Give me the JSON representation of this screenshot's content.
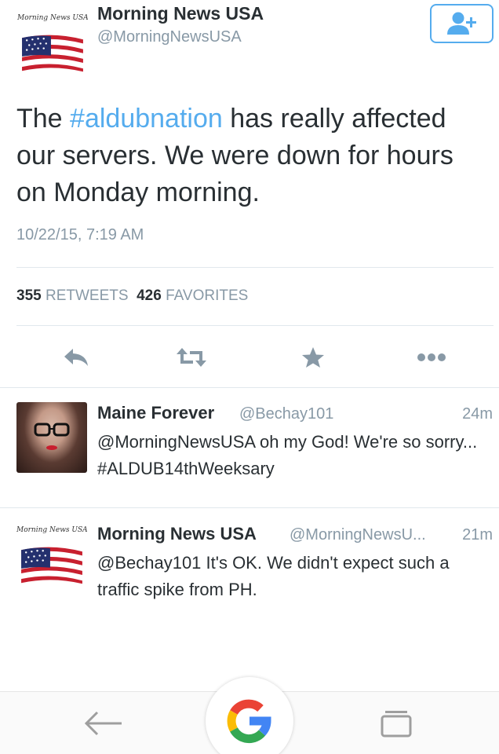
{
  "main_tweet": {
    "display_name": "Morning News USA",
    "handle": "@MorningNewsUSA",
    "avatar_wordmark": "Morning News USA",
    "text_before": "The ",
    "hashtag": "#aldubnation",
    "text_after": " has really affected our servers. We were down for hours on Monday morning.",
    "timestamp": "10/22/15, 7:19 AM",
    "retweets_count": "355",
    "retweets_label": "RETWEETS",
    "favorites_count": "426",
    "favorites_label": "FAVORITES"
  },
  "follow_button": {
    "icon": "add-user-icon",
    "color": "#55acee"
  },
  "actions": [
    {
      "icon": "reply-icon"
    },
    {
      "icon": "retweet-icon"
    },
    {
      "icon": "star-icon"
    },
    {
      "icon": "more-icon"
    }
  ],
  "replies": [
    {
      "display_name": "Maine Forever",
      "handle": "@Bechay101",
      "time": "24m",
      "text": "@MorningNewsUSA oh my God! We're so sorry... #ALDUB14thWeeksary"
    },
    {
      "display_name": "Morning News USA",
      "handle": "@MorningNewsU...",
      "time": "21m",
      "avatar_wordmark": "Morning News USA",
      "text": "@Bechay101 It's OK. We didn't expect such a traffic spike from PH."
    }
  ],
  "nav": {
    "back_icon": "back-arrow-icon",
    "home_icon": "google-icon",
    "recents_icon": "recents-icon"
  },
  "colors": {
    "accent": "#55acee",
    "text": "#292f33",
    "muted": "#8899a6",
    "divider": "#e1e8ed"
  }
}
